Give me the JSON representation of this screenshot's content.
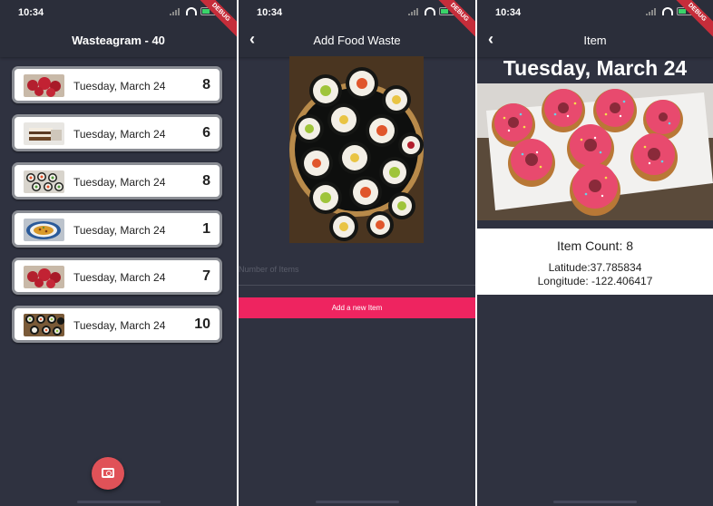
{
  "list_screen": {
    "status_time": "10:34",
    "debug_label": "DEBUG",
    "title": "Wasteagram - 40",
    "items": [
      {
        "date": "Tuesday, March 24",
        "count": "8",
        "thumbnail": "red-donuts-photo"
      },
      {
        "date": "Tuesday, March 24",
        "count": "6",
        "thumbnail": "layer-cake-photo"
      },
      {
        "date": "Tuesday, March 24",
        "count": "8",
        "thumbnail": "sushi-rolls-photo"
      },
      {
        "date": "Tuesday, March 24",
        "count": "1",
        "thumbnail": "pasta-plate-photo"
      },
      {
        "date": "Tuesday, March 24",
        "count": "7",
        "thumbnail": "red-donuts-photo"
      },
      {
        "date": "Tuesday, March 24",
        "count": "10",
        "thumbnail": "sushi-platter-photo"
      }
    ],
    "fab_icon": "add-photo-icon"
  },
  "add_screen": {
    "status_time": "10:34",
    "debug_label": "DEBUG",
    "title": "Add Food Waste",
    "back_icon": "back-chevron-icon",
    "image": "sushi-platter-photo",
    "field_placeholder": "Number of Items",
    "button_label": "Add a new Item"
  },
  "detail_screen": {
    "status_time": "10:34",
    "debug_label": "DEBUG",
    "title": "Item",
    "back_icon": "back-chevron-icon",
    "date": "Tuesday, March 24",
    "image": "pink-donuts-photo",
    "count_text": "Item Count: 8",
    "latitude_text": "Latitude:37.785834",
    "longitude_text": "Longitude: -122.406417"
  },
  "colors": {
    "background": "#2f3240",
    "appbar": "#2b2e3a",
    "accent_button": "#ee2460",
    "fab": "#e05258",
    "card_border": "#8a8d94"
  }
}
